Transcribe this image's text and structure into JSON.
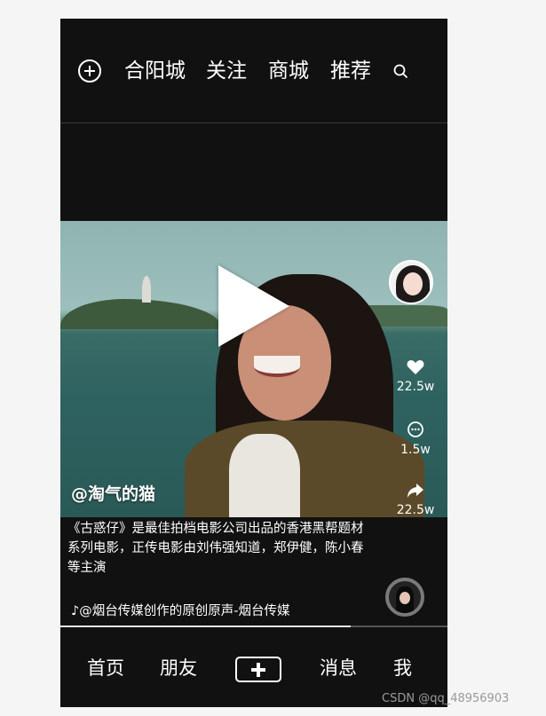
{
  "top_tabs": [
    "合阳城",
    "关注",
    "商城",
    "推荐"
  ],
  "video": {
    "author": "@淘气的猫",
    "description": "《古惑仔》是最佳拍档电影公司出品的香港黑帮题材系列电影，正传电影由刘伟强知道，郑伊健，陈小春等主演",
    "music": "@烟台传媒创作的原创原声-烟台传媒",
    "likes": "22.5w",
    "comments": "1.5w",
    "shares": "22.5w",
    "progress_fraction": 0.75
  },
  "bottom_nav": {
    "home": "首页",
    "friends": "朋友",
    "messages": "消息",
    "me": "我"
  },
  "watermark": "CSDN @qq_48956903",
  "icons": {
    "add": "plus-circle-icon",
    "search": "search-icon",
    "like": "heart-icon",
    "comment": "comment-icon",
    "share": "share-icon",
    "music": "music-note-icon",
    "publish": "plus-box-icon"
  }
}
